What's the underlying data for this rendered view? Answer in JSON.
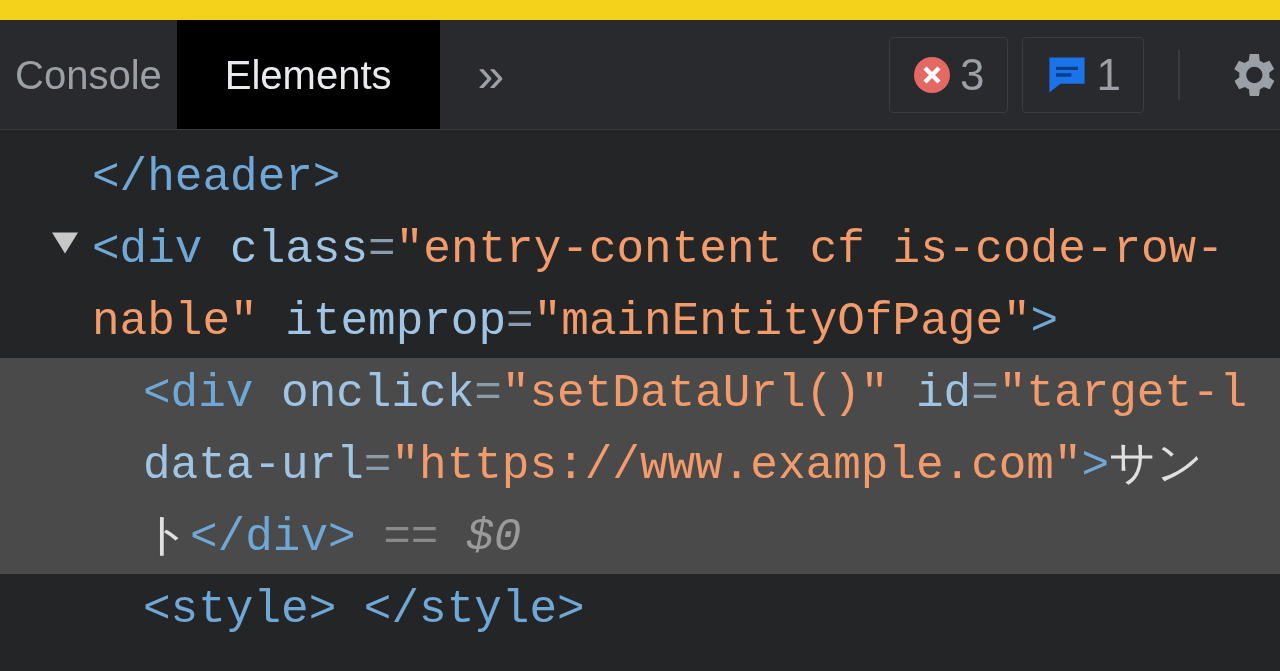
{
  "tabs": [
    {
      "label": "Console",
      "selected": false
    },
    {
      "label": "Elements",
      "selected": true
    }
  ],
  "more_tabs": "»",
  "badges": [
    {
      "kind": "error",
      "count": "3"
    },
    {
      "kind": "message",
      "count": "1"
    }
  ],
  "dom_tree": [
    {
      "selected": false,
      "lines": [
        [
          {
            "kind": "tag",
            "text": "</header>"
          }
        ]
      ]
    },
    {
      "selected": false,
      "expanded": true,
      "lines": [
        [
          {
            "kind": "tag",
            "text": "<div"
          },
          {
            "kind": "attr",
            "text": " class"
          },
          {
            "kind": "punct",
            "text": "="
          },
          {
            "kind": "value",
            "text": "\"entry-content cf is-code-row-"
          }
        ],
        [
          {
            "kind": "value",
            "text": "nable\""
          },
          {
            "kind": "attr",
            "text": " itemprop"
          },
          {
            "kind": "punct",
            "text": "="
          },
          {
            "kind": "value",
            "text": "\"mainEntityOfPage\""
          },
          {
            "kind": "tag",
            "text": ">"
          }
        ]
      ],
      "children": [
        {
          "selected": true,
          "lines": [
            [
              {
                "kind": "tag",
                "text": "<div"
              },
              {
                "kind": "attr",
                "text": " onclick"
              },
              {
                "kind": "punct",
                "text": "="
              },
              {
                "kind": "value",
                "text": "\"setDataUrl()\""
              },
              {
                "kind": "attr",
                "text": " id"
              },
              {
                "kind": "punct",
                "text": "="
              },
              {
                "kind": "value",
                "text": "\"target-l"
              }
            ],
            [
              {
                "kind": "attr",
                "text": "data-url"
              },
              {
                "kind": "punct",
                "text": "="
              },
              {
                "kind": "value",
                "text": "\"https://www.example.com\""
              },
              {
                "kind": "tag",
                "text": ">"
              },
              {
                "kind": "text",
                "text": "サン"
              }
            ],
            [
              {
                "kind": "text",
                "text": "ト"
              },
              {
                "kind": "tag",
                "text": "</div>"
              },
              {
                "kind": "note",
                "text": " == "
              },
              {
                "kind": "var",
                "text": "$0"
              }
            ]
          ]
        },
        {
          "selected": false,
          "lines": [
            [
              {
                "kind": "tag",
                "text": "<style>"
              },
              {
                "kind": "tag",
                "text": " </style>"
              }
            ]
          ]
        }
      ]
    }
  ]
}
